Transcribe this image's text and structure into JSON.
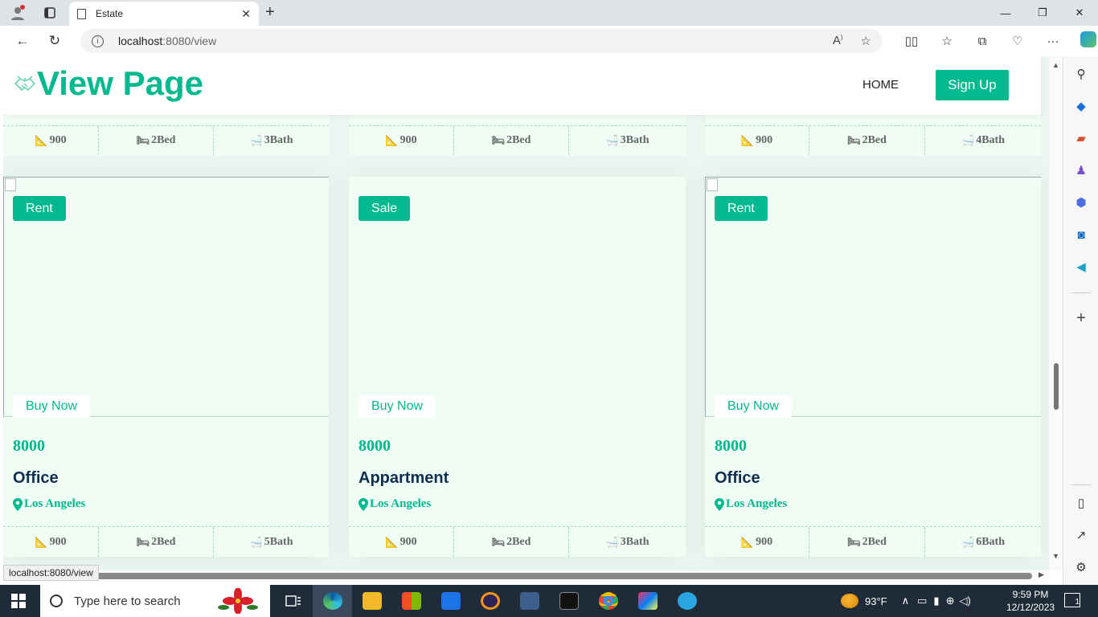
{
  "browser": {
    "tab_title": "Estate",
    "url_host": "localhost",
    "url_path": ":8080/view",
    "status_url": "localhost:8080/view"
  },
  "header": {
    "title": "View Page",
    "nav_home": "HOME",
    "signup_label": "Sign Up"
  },
  "top_features": [
    {
      "area": "900",
      "beds": "2Bed",
      "baths": "3Bath"
    },
    {
      "area": "900",
      "beds": "2Bed",
      "baths": "3Bath"
    },
    {
      "area": "900",
      "beds": "2Bed",
      "baths": "4Bath"
    }
  ],
  "listings": [
    {
      "status": "Rent",
      "buy_label": "Buy Now",
      "price": "8000",
      "type": "Office",
      "location": "Los Angeles",
      "area": "900",
      "beds": "2Bed",
      "baths": "5Bath"
    },
    {
      "status": "Sale",
      "buy_label": "Buy Now",
      "price": "8000",
      "type": "Appartment",
      "location": "Los Angeles",
      "area": "900",
      "beds": "2Bed",
      "baths": "3Bath"
    },
    {
      "status": "Rent",
      "buy_label": "Buy Now",
      "price": "8000",
      "type": "Office",
      "location": "Los Angeles",
      "area": "900",
      "beds": "2Bed",
      "baths": "6Bath"
    }
  ],
  "taskbar": {
    "search_placeholder": "Type here to search",
    "weather": "93°F",
    "time": "9:59 PM",
    "date": "12/12/2023",
    "notification_count": "1"
  },
  "colors": {
    "accent": "#00b98e",
    "card_bg": "#effdf5",
    "page_bg": "#eaf6f0",
    "dark_text": "#0e2e50"
  }
}
